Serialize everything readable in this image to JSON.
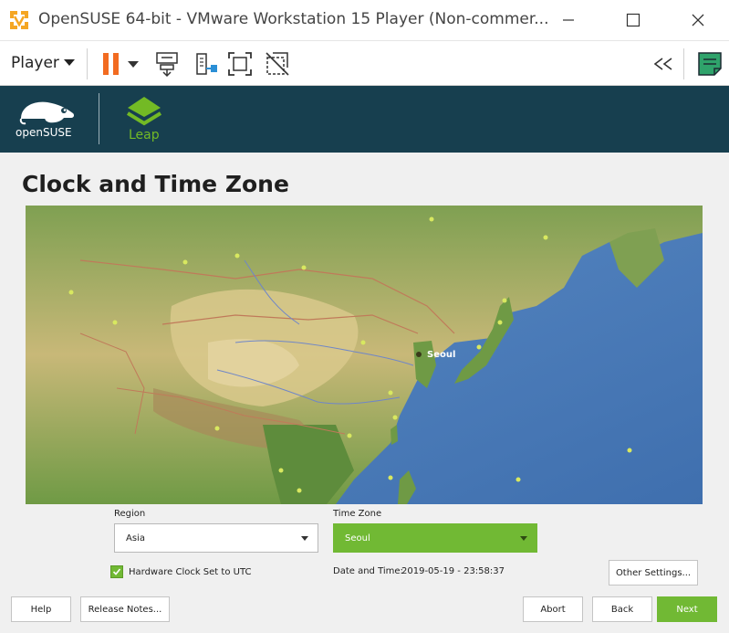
{
  "window": {
    "title": "OpenSUSE 64-bit - VMware Workstation 15 Player (Non-commer..."
  },
  "toolbar": {
    "player_label": "Player"
  },
  "header": {
    "brand": "openSUSE",
    "product": "Leap"
  },
  "page": {
    "title": "Clock and Time Zone"
  },
  "map": {
    "selected_city": "Seoul"
  },
  "form": {
    "region_label": "Region",
    "region_value": "Asia",
    "timezone_label": "Time Zone",
    "timezone_value": "Seoul",
    "hw_clock_label": "Hardware Clock Set to UTC",
    "hw_clock_checked": true,
    "datetime_label": "Date and Time:",
    "datetime_value": "2019-05-19 - 23:58:37",
    "other_settings": "Other Settings..."
  },
  "buttons": {
    "help": "Help",
    "release_notes": "Release Notes...",
    "abort": "Abort",
    "back": "Back",
    "next": "Next"
  },
  "colors": {
    "accent_green": "#71b934",
    "header_bg": "#173f4f",
    "pause_orange": "#f26b21",
    "note_green": "#2fa36b"
  }
}
